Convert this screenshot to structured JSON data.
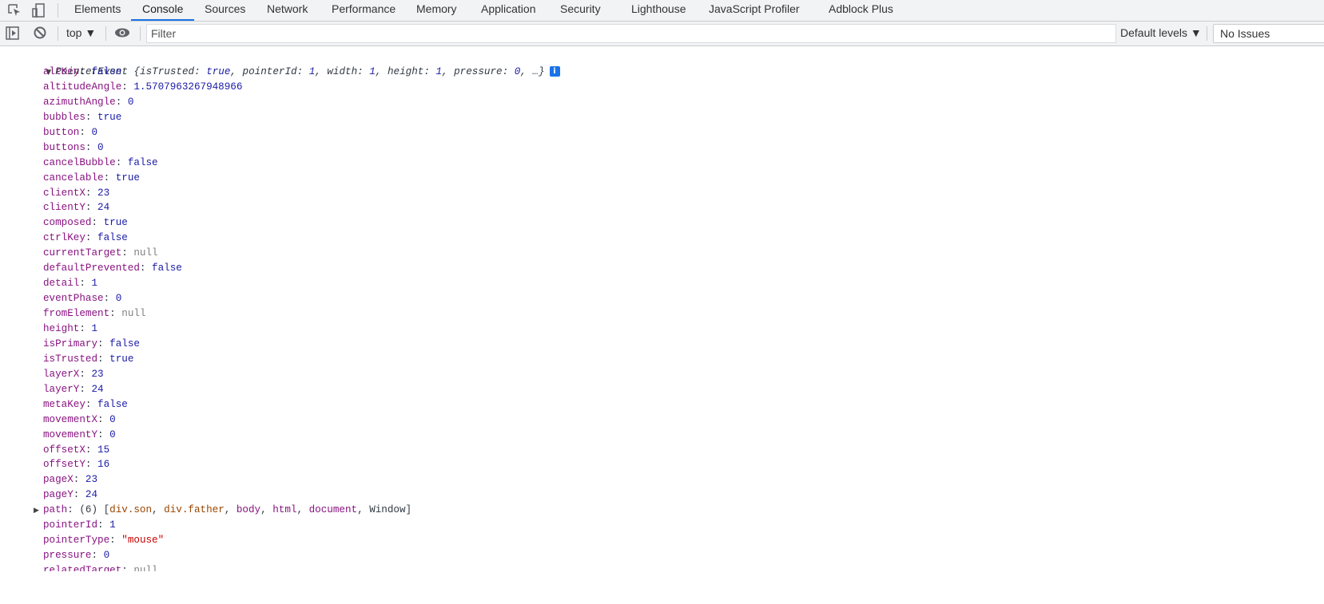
{
  "tabs": [
    "Elements",
    "Console",
    "Sources",
    "Network",
    "Performance",
    "Memory",
    "Application",
    "Security",
    "Lighthouse",
    "JavaScript Profiler",
    "Adblock Plus"
  ],
  "active_tab": "Console",
  "toolbar": {
    "context": "top ▼",
    "filter_placeholder": "Filter",
    "levels": "Default levels ▼",
    "issues": "No Issues"
  },
  "event": {
    "summary_type": "PointerEvent",
    "summary": [
      [
        "isTrusted",
        "true"
      ],
      [
        "pointerId",
        "1"
      ],
      [
        "width",
        "1"
      ],
      [
        "height",
        "1"
      ],
      [
        "pressure",
        "0"
      ]
    ],
    "properties": [
      [
        "altKey",
        "false",
        "num"
      ],
      [
        "altitudeAngle",
        "1.5707963267948966",
        "num"
      ],
      [
        "azimuthAngle",
        "0",
        "num"
      ],
      [
        "bubbles",
        "true",
        "num"
      ],
      [
        "button",
        "0",
        "num"
      ],
      [
        "buttons",
        "0",
        "num"
      ],
      [
        "cancelBubble",
        "false",
        "num"
      ],
      [
        "cancelable",
        "true",
        "num"
      ],
      [
        "clientX",
        "23",
        "num"
      ],
      [
        "clientY",
        "24",
        "num"
      ],
      [
        "composed",
        "true",
        "num"
      ],
      [
        "ctrlKey",
        "false",
        "num"
      ],
      [
        "currentTarget",
        "null",
        "nul"
      ],
      [
        "defaultPrevented",
        "false",
        "num"
      ],
      [
        "detail",
        "1",
        "num"
      ],
      [
        "eventPhase",
        "0",
        "num"
      ],
      [
        "fromElement",
        "null",
        "nul"
      ],
      [
        "height",
        "1",
        "num"
      ],
      [
        "isPrimary",
        "false",
        "num"
      ],
      [
        "isTrusted",
        "true",
        "num"
      ],
      [
        "layerX",
        "23",
        "num"
      ],
      [
        "layerY",
        "24",
        "num"
      ],
      [
        "metaKey",
        "false",
        "num"
      ],
      [
        "movementX",
        "0",
        "num"
      ],
      [
        "movementY",
        "0",
        "num"
      ],
      [
        "offsetX",
        "15",
        "num"
      ],
      [
        "offsetY",
        "16",
        "num"
      ],
      [
        "pageX",
        "23",
        "num"
      ],
      [
        "pageY",
        "24",
        "num"
      ],
      [
        "path",
        "",
        "path"
      ],
      [
        "pointerId",
        "1",
        "num"
      ],
      [
        "pointerType",
        "\"mouse\"",
        "str"
      ],
      [
        "pressure",
        "0",
        "num"
      ],
      [
        "relatedTarget",
        "null",
        "nul"
      ]
    ],
    "path": {
      "count": "(6)",
      "items": [
        [
          "div.son",
          "node"
        ],
        [
          "div.father",
          "node"
        ],
        [
          "body",
          "tag"
        ],
        [
          "html",
          "tag"
        ],
        [
          "document",
          "tag"
        ],
        [
          "Window",
          "plain"
        ]
      ]
    }
  }
}
